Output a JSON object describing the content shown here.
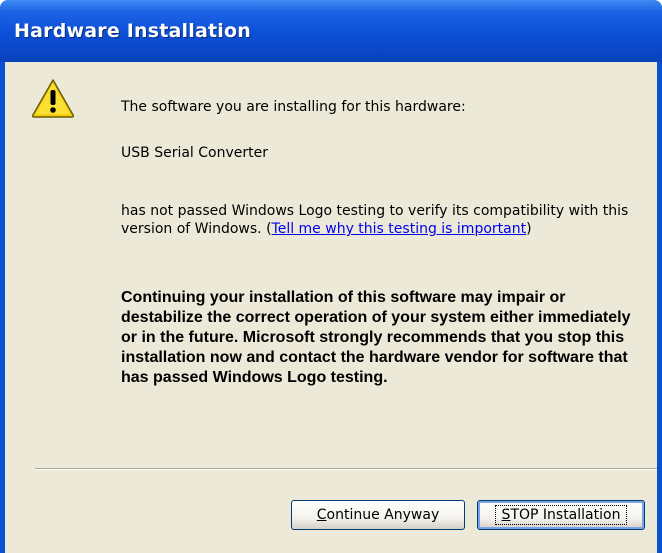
{
  "window": {
    "title": "Hardware Installation"
  },
  "icon": {
    "type": "warning-icon",
    "color": "#f5d00f"
  },
  "message": {
    "intro": "The software you are installing for this hardware:",
    "device": "USB Serial Converter",
    "body": "has not passed Windows Logo testing to verify its compatibility with this version of Windows. (",
    "link": "Tell me why this testing is important",
    "body_end": ")",
    "warning": "Continuing your installation of this software may impair or destabilize the correct operation of your system either immediately or in the future. Microsoft strongly recommends that you stop this installation now and contact the hardware vendor for software that has passed Windows Logo testing."
  },
  "buttons": {
    "continue_mnemonic": "C",
    "continue_rest": "ontinue Anyway",
    "stop_mnemonic": "S",
    "stop_rest": "TOP Installation"
  },
  "colors": {
    "titlebar": "#0a4fd8",
    "dialog_bg": "#ece9d8",
    "link": "#0000ee"
  }
}
